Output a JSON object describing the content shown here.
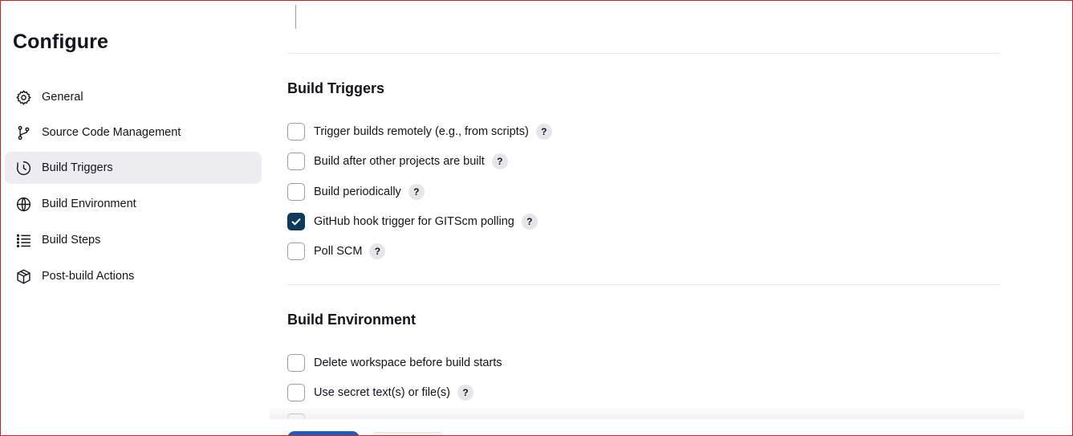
{
  "sidebar": {
    "title": "Configure",
    "items": [
      {
        "label": "General",
        "icon": "gear-icon",
        "active": false
      },
      {
        "label": "Source Code Management",
        "icon": "branch-icon",
        "active": false
      },
      {
        "label": "Build Triggers",
        "icon": "clock-icon",
        "active": true
      },
      {
        "label": "Build Environment",
        "icon": "globe-icon",
        "active": false
      },
      {
        "label": "Build Steps",
        "icon": "list-icon",
        "active": false
      },
      {
        "label": "Post-build Actions",
        "icon": "package-icon",
        "active": false
      }
    ]
  },
  "main": {
    "build_triggers": {
      "title": "Build Triggers",
      "options": [
        {
          "label": "Trigger builds remotely (e.g., from scripts)",
          "checked": false,
          "help": "?"
        },
        {
          "label": "Build after other projects are built",
          "checked": false,
          "help": "?"
        },
        {
          "label": "Build periodically",
          "checked": false,
          "help": "?"
        },
        {
          "label": "GitHub hook trigger for GITScm polling",
          "checked": true,
          "help": "?"
        },
        {
          "label": "Poll SCM",
          "checked": false,
          "help": "?"
        }
      ]
    },
    "build_environment": {
      "title": "Build Environment",
      "options": [
        {
          "label": "Delete workspace before build starts",
          "checked": false
        },
        {
          "label": "Use secret text(s) or file(s)",
          "checked": false,
          "help": "?"
        }
      ]
    }
  },
  "colors": {
    "checked": "#0b3a5c",
    "active_nav": "#ececf1",
    "save_button": "#1a5fbf"
  }
}
